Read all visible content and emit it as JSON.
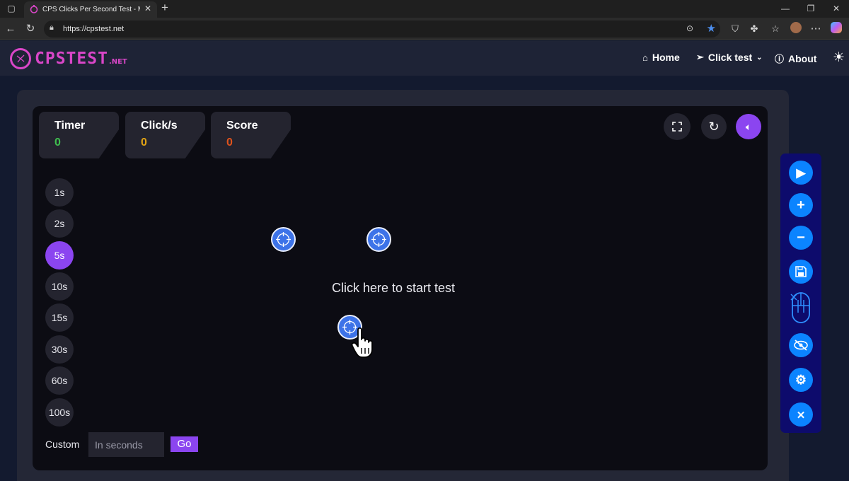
{
  "browser": {
    "tab_title": "CPS Clicks Per Second Test - Mea",
    "url": "https://cpstest.net"
  },
  "site": {
    "logo_text": "CPSTEST",
    "logo_suffix": ".NET",
    "nav": [
      {
        "label": "Home",
        "icon": "home-icon"
      },
      {
        "label": "Click test",
        "icon": "pointer-icon"
      },
      {
        "label": "About",
        "icon": "info-icon"
      }
    ]
  },
  "stats": {
    "timer_label": "Timer",
    "timer_value": "0",
    "cps_label": "Click/s",
    "cps_value": "0",
    "score_label": "Score",
    "score_value": "0"
  },
  "durations": [
    "1s",
    "2s",
    "5s",
    "10s",
    "15s",
    "30s",
    "60s",
    "100s"
  ],
  "selected_duration": "5s",
  "custom": {
    "label": "Custom",
    "placeholder": "In seconds",
    "go_label": "Go"
  },
  "start_prompt": "Click here to start test",
  "colors": {
    "accent": "#8b45f0",
    "timer": "#3fbf4f",
    "cps": "#e0a214",
    "score": "#e0531c",
    "logo": "#d946c8",
    "toolbar_btn": "#0b84ff"
  },
  "floating_toolbar": [
    "play-icon",
    "plus-icon",
    "minus-icon",
    "save-icon",
    "mouse-icon",
    "hide-eye-icon",
    "settings-icon",
    "close-icon"
  ]
}
